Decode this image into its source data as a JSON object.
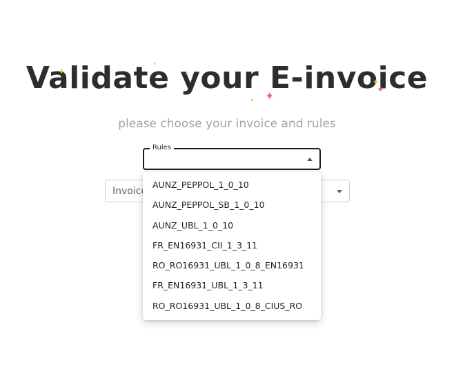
{
  "hero": {
    "title": "Validate your E-invoice",
    "subtitle": "please choose your invoice and rules"
  },
  "rules_select": {
    "label": "Rules",
    "value": "",
    "icon": "caret-up-icon",
    "options": [
      "AUNZ_PEPPOL_1_0_10",
      "AUNZ_PEPPOL_SB_1_0_10",
      "AUNZ_UBL_1_0_10",
      "FR_EN16931_CII_1_3_11",
      "RO_RO16931_UBL_1_0_8_EN16931",
      "FR_EN16931_UBL_1_3_11",
      "RO_RO16931_UBL_1_0_8_CIUS_RO"
    ]
  },
  "invoice_select": {
    "label": "Invoice",
    "icon": "caret-down-icon"
  },
  "colors": {
    "title": "#2d2d2d",
    "subtitle": "#a3a3a3",
    "sparkle_pink": "#e8609a",
    "sparkle_gold": "#f2c233"
  }
}
